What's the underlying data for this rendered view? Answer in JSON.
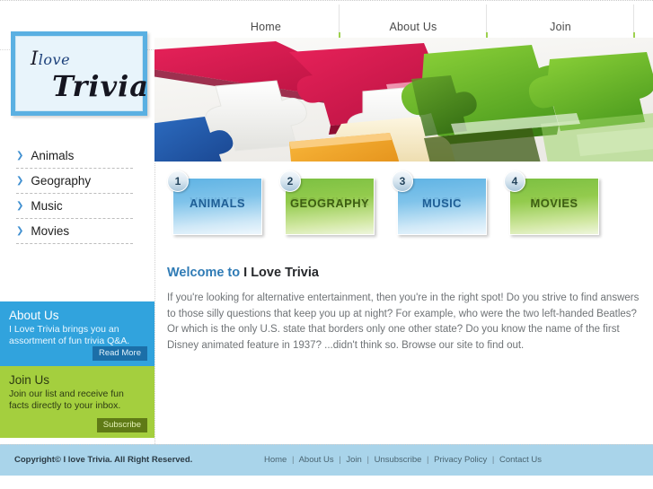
{
  "site": {
    "logo_line1": "I",
    "logo_line1_em": "love",
    "logo_line2": "Trivia"
  },
  "topnav": {
    "items": [
      {
        "label": "Home"
      },
      {
        "label": "About Us"
      },
      {
        "label": "Join"
      }
    ]
  },
  "banner": {
    "alt": "colorful 3d jigsaw puzzle pieces"
  },
  "sidebar": {
    "menu": [
      {
        "label": "Animals",
        "arrow": "❯"
      },
      {
        "label": "Geography",
        "arrow": "❯"
      },
      {
        "label": "Music",
        "arrow": "❯"
      },
      {
        "label": "Movies",
        "arrow": "❯"
      }
    ],
    "about": {
      "title": "About Us",
      "text": "I Love Trivia brings you an assortment of fun trivia Q&A.",
      "button": "Read More",
      "bg_color": "#31a3dd",
      "button_color": "#1b6fa8"
    },
    "join": {
      "title": "Join Us",
      "text": "Join our list and receive fun facts directly to your inbox.",
      "button": "Subscribe",
      "bg_color": "#a4cf3e",
      "button_color": "#5f7a16"
    }
  },
  "tiles": [
    {
      "number": "1",
      "label": "ANIMALS",
      "color": "blue"
    },
    {
      "number": "2",
      "label": "GEOGRAPHY",
      "color": "green"
    },
    {
      "number": "3",
      "label": "MUSIC",
      "color": "blue"
    },
    {
      "number": "4",
      "label": "MOVIES",
      "color": "green"
    }
  ],
  "content": {
    "heading_accent": "Welcome to",
    "heading_rest": " I Love Trivia",
    "body": "If you're looking for alternative entertainment, then you're in the right spot! Do you strive to find answers to those silly questions that keep you up at night? For example, who were the two left-handed Beatles? Or which is the only U.S. state that borders only one other state? Do you know the name of the first Disney animated feature in 1937? ...didn't think so. Browse our site to find out."
  },
  "footer": {
    "copyright": "Copyright© I love Trivia. All Right Reserved.",
    "links": [
      "Home",
      "About Us",
      "Join",
      "Unsubscribe",
      "Privacy Policy",
      "Contact Us"
    ],
    "separator": "|",
    "bg_color": "#a9d4ea"
  }
}
